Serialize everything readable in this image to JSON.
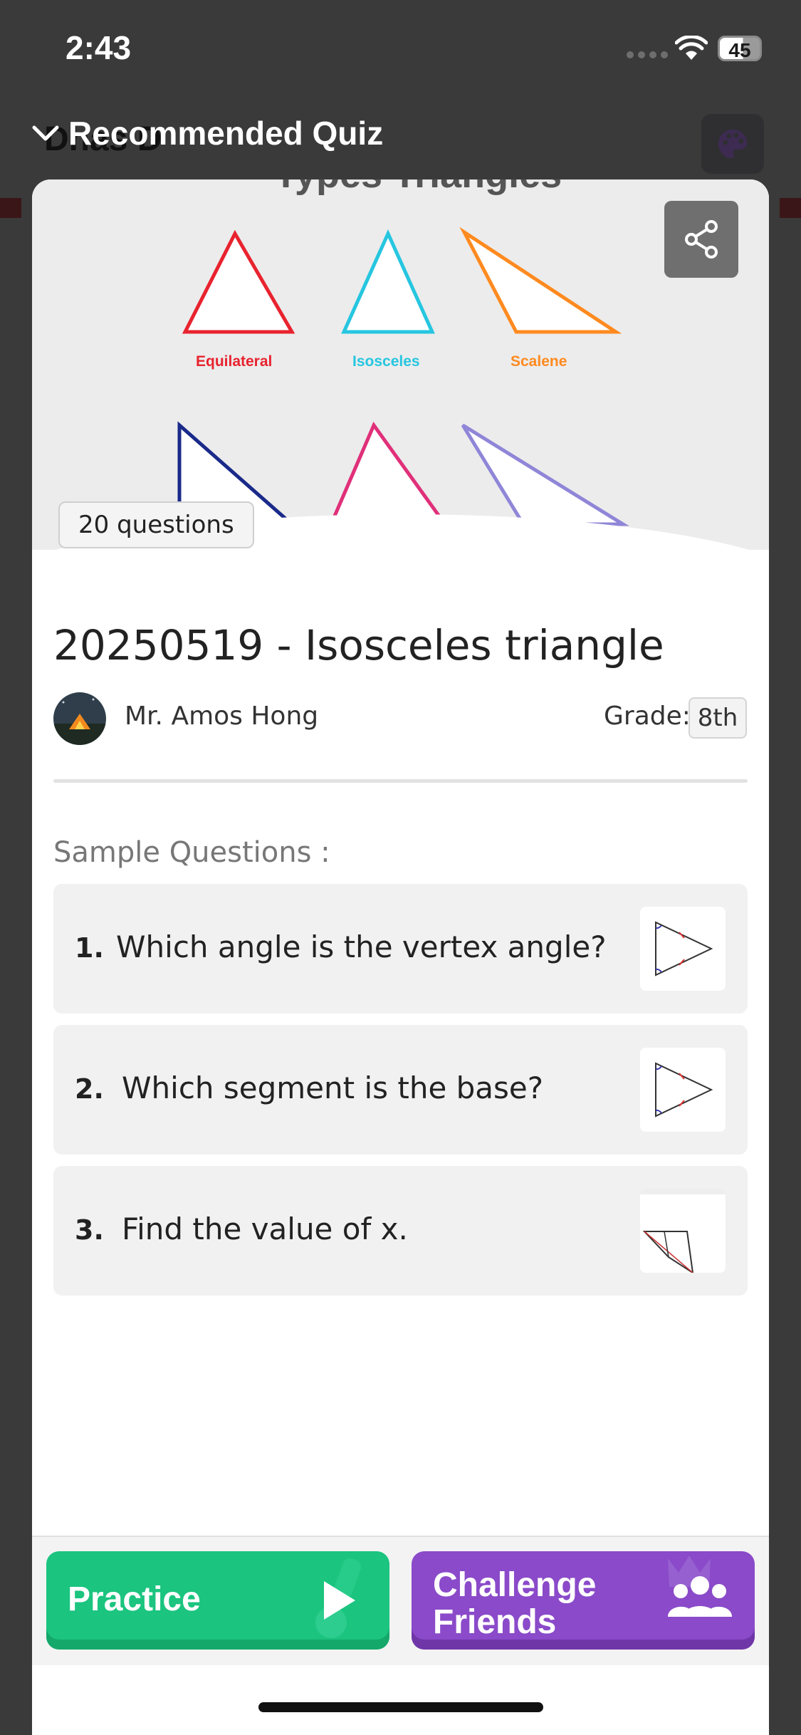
{
  "status_bar": {
    "time": "2:43",
    "battery": "45"
  },
  "backdrop": {
    "title": "Dhas D"
  },
  "sheet": {
    "header_title": "Recommended Quiz"
  },
  "hero": {
    "title": "Types Triangles",
    "labels": [
      "Equilateral",
      "Isosceles",
      "Scalene"
    ],
    "question_count": "20 questions"
  },
  "quiz": {
    "title": "20250519 - Isosceles triangle",
    "author": "Mr.  Amos Hong",
    "grade_label": "Grade:",
    "grade_value": "8th"
  },
  "sample": {
    "label": "Sample Questions :",
    "questions": [
      {
        "num": "1.",
        "text": "Which angle is the vertex angle?"
      },
      {
        "num": "2.",
        "text": "Which segment is the base?"
      },
      {
        "num": "3.",
        "text": "Find the value of x."
      }
    ]
  },
  "actions": {
    "practice": "Practice",
    "challenge_line1": "Challenge",
    "challenge_line2": "Friends"
  },
  "colors": {
    "practice": "#1bc47f",
    "challenge": "#8a4ac9"
  },
  "icons": [
    "chevron-down-icon",
    "palette-icon",
    "share-icon",
    "play-icon",
    "group-icon",
    "wifi-icon"
  ]
}
